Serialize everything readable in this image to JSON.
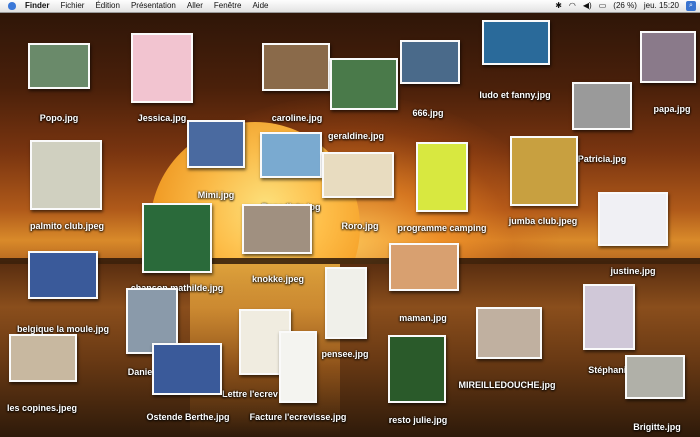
{
  "menubar": {
    "items": [
      "Finder",
      "Fichier",
      "Édition",
      "Présentation",
      "Aller",
      "Fenêtre",
      "Aide"
    ],
    "battery": "(26 %)",
    "clock": "jeu. 15:20"
  },
  "files": [
    {
      "name": "Popo.jpg",
      "color": "#6a8a6a"
    },
    {
      "name": "Jessica.jpg",
      "color": "#f2c4d0"
    },
    {
      "name": "caroline.jpg",
      "color": "#8a6a4a"
    },
    {
      "name": "geraldine.jpg",
      "color": "#4a7a4a"
    },
    {
      "name": "666.jpg",
      "color": "#4a6a8a"
    },
    {
      "name": "ludo et fanny.jpg",
      "color": "#2a6a9a"
    },
    {
      "name": "papa.jpg",
      "color": "#8a7a8a"
    },
    {
      "name": "Patricia.jpg",
      "color": "#9a9a9a"
    },
    {
      "name": "Mimi.jpg",
      "color": "#4a6aa0"
    },
    {
      "name": "Benedicte.jpg",
      "color": "#7aaad0"
    },
    {
      "name": "Roro.jpg",
      "color": "#e8dcc0"
    },
    {
      "name": "programme camping",
      "color": "#d8e840"
    },
    {
      "name": "jumba club.jpeg",
      "color": "#c8a040"
    },
    {
      "name": "palmito club.jpeg",
      "color": "#d0d0c0"
    },
    {
      "name": "justine.jpg",
      "color": "#f0f0f4"
    },
    {
      "name": "chanson mathilde.jpg",
      "color": "#2a6a3a"
    },
    {
      "name": "knokke.jpeg",
      "color": "#a09080"
    },
    {
      "name": "maman.jpg",
      "color": "#d8a070"
    },
    {
      "name": "belgique la moule.jpg",
      "color": "#3a5a9a"
    },
    {
      "name": "Danie",
      "color": "#8a9aaa"
    },
    {
      "name": "pensee.jpg",
      "color": "#f0f0ea"
    },
    {
      "name": "MIREILLEDOUCHE.jpg",
      "color": "#c0b0a0"
    },
    {
      "name": "Stéphanie.",
      "color": "#d0c8d8"
    },
    {
      "name": "les copines.jpeg",
      "color": "#c8b8a0"
    },
    {
      "name": "Lettre l'ecrev",
      "color": "#f0ece0"
    },
    {
      "name": "Ostende Berthe.jpg",
      "color": "#3a5a9a"
    },
    {
      "name": "Facture l'ecrevisse.jpg",
      "color": "#f4f4f0"
    },
    {
      "name": "resto julie.jpg",
      "color": "#2a5a2a"
    },
    {
      "name": "Brigitte.jpg",
      "color": "#b0b0a8"
    }
  ]
}
